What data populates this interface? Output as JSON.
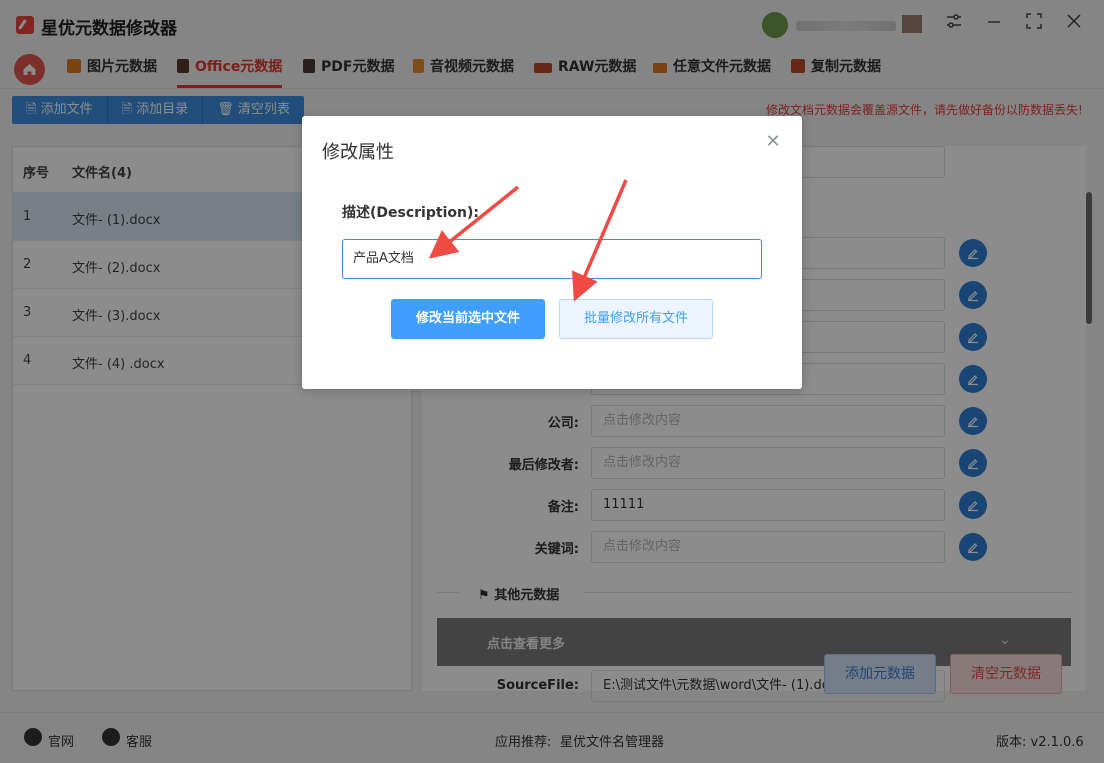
{
  "app": {
    "title": "星优元数据修改器"
  },
  "colors": {
    "accent": "#409eff",
    "brand": "#e03a30",
    "warning": "#e0403a"
  },
  "nav": {
    "tabs": [
      {
        "label": "图片元数据",
        "icon": "image-icon",
        "active": false
      },
      {
        "label": "Office元数据",
        "icon": "office-icon",
        "active": true
      },
      {
        "label": "PDF元数据",
        "icon": "pdf-icon",
        "active": false
      },
      {
        "label": "音视频元数据",
        "icon": "media-icon",
        "active": false
      },
      {
        "label": "RAW元数据",
        "icon": "raw-icon",
        "active": false
      },
      {
        "label": "任意文件元数据",
        "icon": "file-icon",
        "active": false
      },
      {
        "label": "复制元数据",
        "icon": "copy-icon",
        "active": false
      }
    ]
  },
  "toolbar": {
    "add_file": "添加文件",
    "add_dir": "添加目录",
    "clear_list": "清空列表"
  },
  "warning": "修改文档元数据会覆盖源文件，请先做好备份以防数据丢失!",
  "file_list": {
    "headers": {
      "index": "序号",
      "name": "文件名(4)"
    },
    "rows": [
      {
        "index": "1",
        "name": "文件- (1).docx",
        "selected": true
      },
      {
        "index": "2",
        "name": "文件- (2).docx",
        "selected": false
      },
      {
        "index": "3",
        "name": "文件- (3).docx",
        "selected": false
      },
      {
        "index": "4",
        "name": "文件- (4) .docx",
        "selected": false
      }
    ]
  },
  "meta": {
    "fields": [
      {
        "label": "公司:",
        "value": "",
        "placeholder": "点击修改内容"
      },
      {
        "label": "最后修改者:",
        "value": "",
        "placeholder": "点击修改内容"
      },
      {
        "label": "备注:",
        "value": "11111",
        "placeholder": "点击修改内容"
      },
      {
        "label": "关键词:",
        "value": "",
        "placeholder": "点击修改内容"
      }
    ],
    "other_section": "其他元数据",
    "more": "点击查看更多",
    "source_label": "SourceFile:",
    "source_value": "E:\\测试文件\\元数据\\word\\文件- (1).docx",
    "add_meta": "添加元数据",
    "clear_meta": "清空元数据"
  },
  "status": {
    "website": "官网",
    "support": "客服",
    "recommend": "应用推荐:",
    "recommend_app": "星优文件名管理器",
    "version": "版本: v2.1.0.6"
  },
  "dialog": {
    "title": "修改属性",
    "field_label": "描述(Description):",
    "field_value": "产品A文档",
    "btn_current": "修改当前选中文件",
    "btn_all": "批量修改所有文件"
  }
}
